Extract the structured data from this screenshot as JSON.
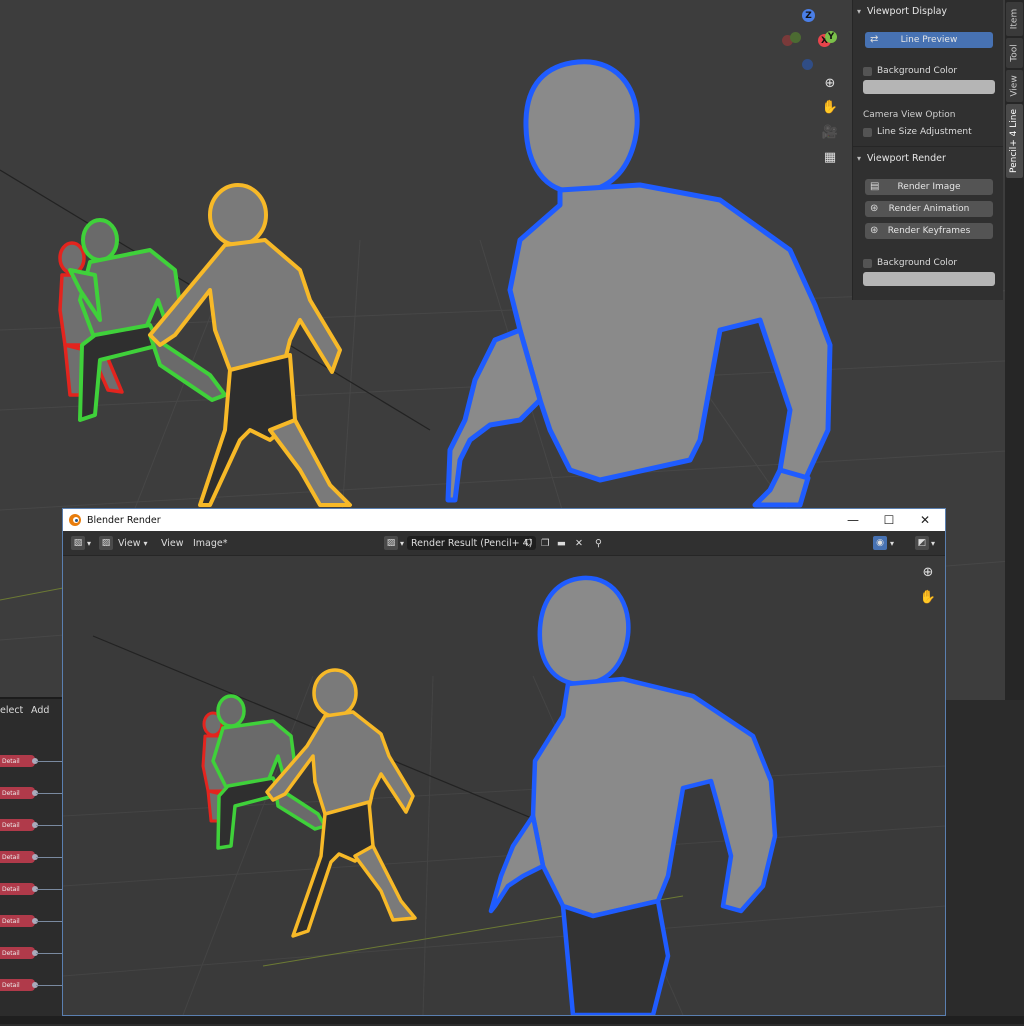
{
  "viewport": {
    "gizmo": {
      "z": "Z",
      "x": "X",
      "y": "Y"
    },
    "nav_icons": [
      "zoom-icon",
      "hand-pan-icon",
      "camera-icon",
      "grid-ortho-icon"
    ]
  },
  "npanel": {
    "viewport_display": {
      "header": "Viewport Display",
      "line_preview": "Line Preview",
      "background_color": "Background Color",
      "camera_view_option": "Camera View Option",
      "line_size_adjustment": "Line Size Adjustment"
    },
    "viewport_render": {
      "header": "Viewport Render",
      "render_image": "Render Image",
      "render_animation": "Render Animation",
      "render_keyframes": "Render Keyframes",
      "background_color": "Background Color"
    }
  },
  "tabs": [
    "Item",
    "Tool",
    "View",
    "Pencil+ 4 Line"
  ],
  "node_editor": {
    "menu": [
      "elect",
      "Add"
    ],
    "node_label": "Detail",
    "node_count": 8
  },
  "render_window": {
    "title": "Blender Render",
    "controls": {
      "minimize": "—",
      "maximize": "☐",
      "close": "✕"
    },
    "menu": {
      "view_dropdown": "View",
      "view": "View",
      "image": "Image*"
    },
    "image_name": "Render Result (Pencil+ 4)"
  },
  "colors": {
    "accent": "#4772b3",
    "outline_blue": "#1f5cff",
    "outline_yellow": "#f7b928",
    "outline_green": "#3fd13a",
    "outline_red": "#e3241e",
    "body_gray": "#8f8f8f"
  }
}
